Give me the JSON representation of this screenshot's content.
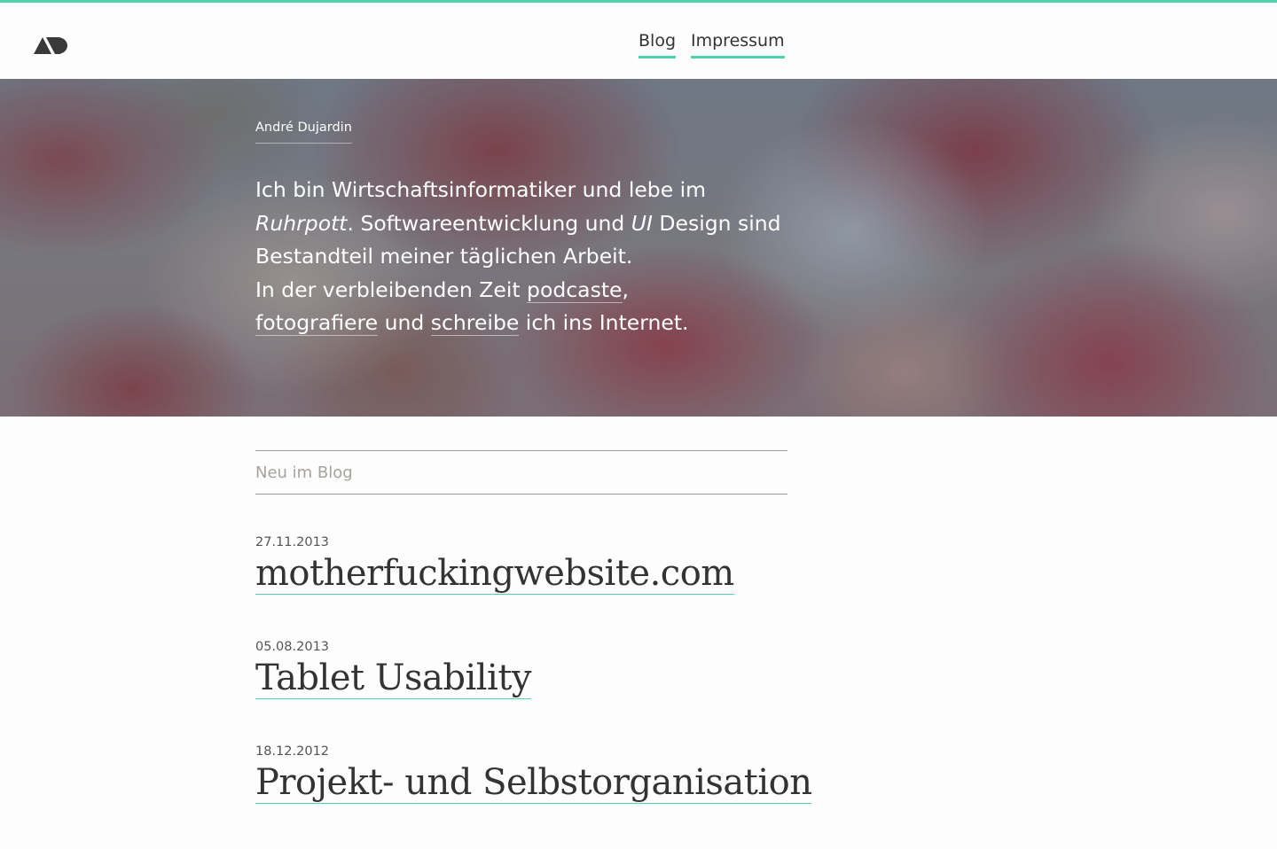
{
  "colors": {
    "accent": "#4fd1b0",
    "text": "#333333",
    "muted": "#a8a29c"
  },
  "header": {
    "logo_icon": "ad-logo-icon",
    "nav": [
      {
        "label": "Blog"
      },
      {
        "label": "Impressum"
      }
    ]
  },
  "hero": {
    "author": "André Dujardin",
    "bio": {
      "p1": "Ich bin Wirtschaftsinformatiker und lebe im ",
      "p1_em": "Ruhrpott",
      "p2": ". Softwareentwicklung und ",
      "p2_em": "UI",
      "p3": " Design sind Bestandteil meiner täglichen Arbeit.",
      "p4": "In der verbleibenden Zeit ",
      "link_podcast": "podcaste",
      "p5": ",",
      "link_photo": "fotografiere",
      "p6": " und ",
      "link_write": "schreibe",
      "p7": " ich ins Internet."
    }
  },
  "blog": {
    "section_title": "Neu im Blog",
    "posts": [
      {
        "date": "27.11.2013",
        "title": "motherfuckingwebsite.com"
      },
      {
        "date": "05.08.2013",
        "title": "Tablet Usability"
      },
      {
        "date": "18.12.2012",
        "title": "Projekt- und Selbstorganisation"
      }
    ]
  }
}
